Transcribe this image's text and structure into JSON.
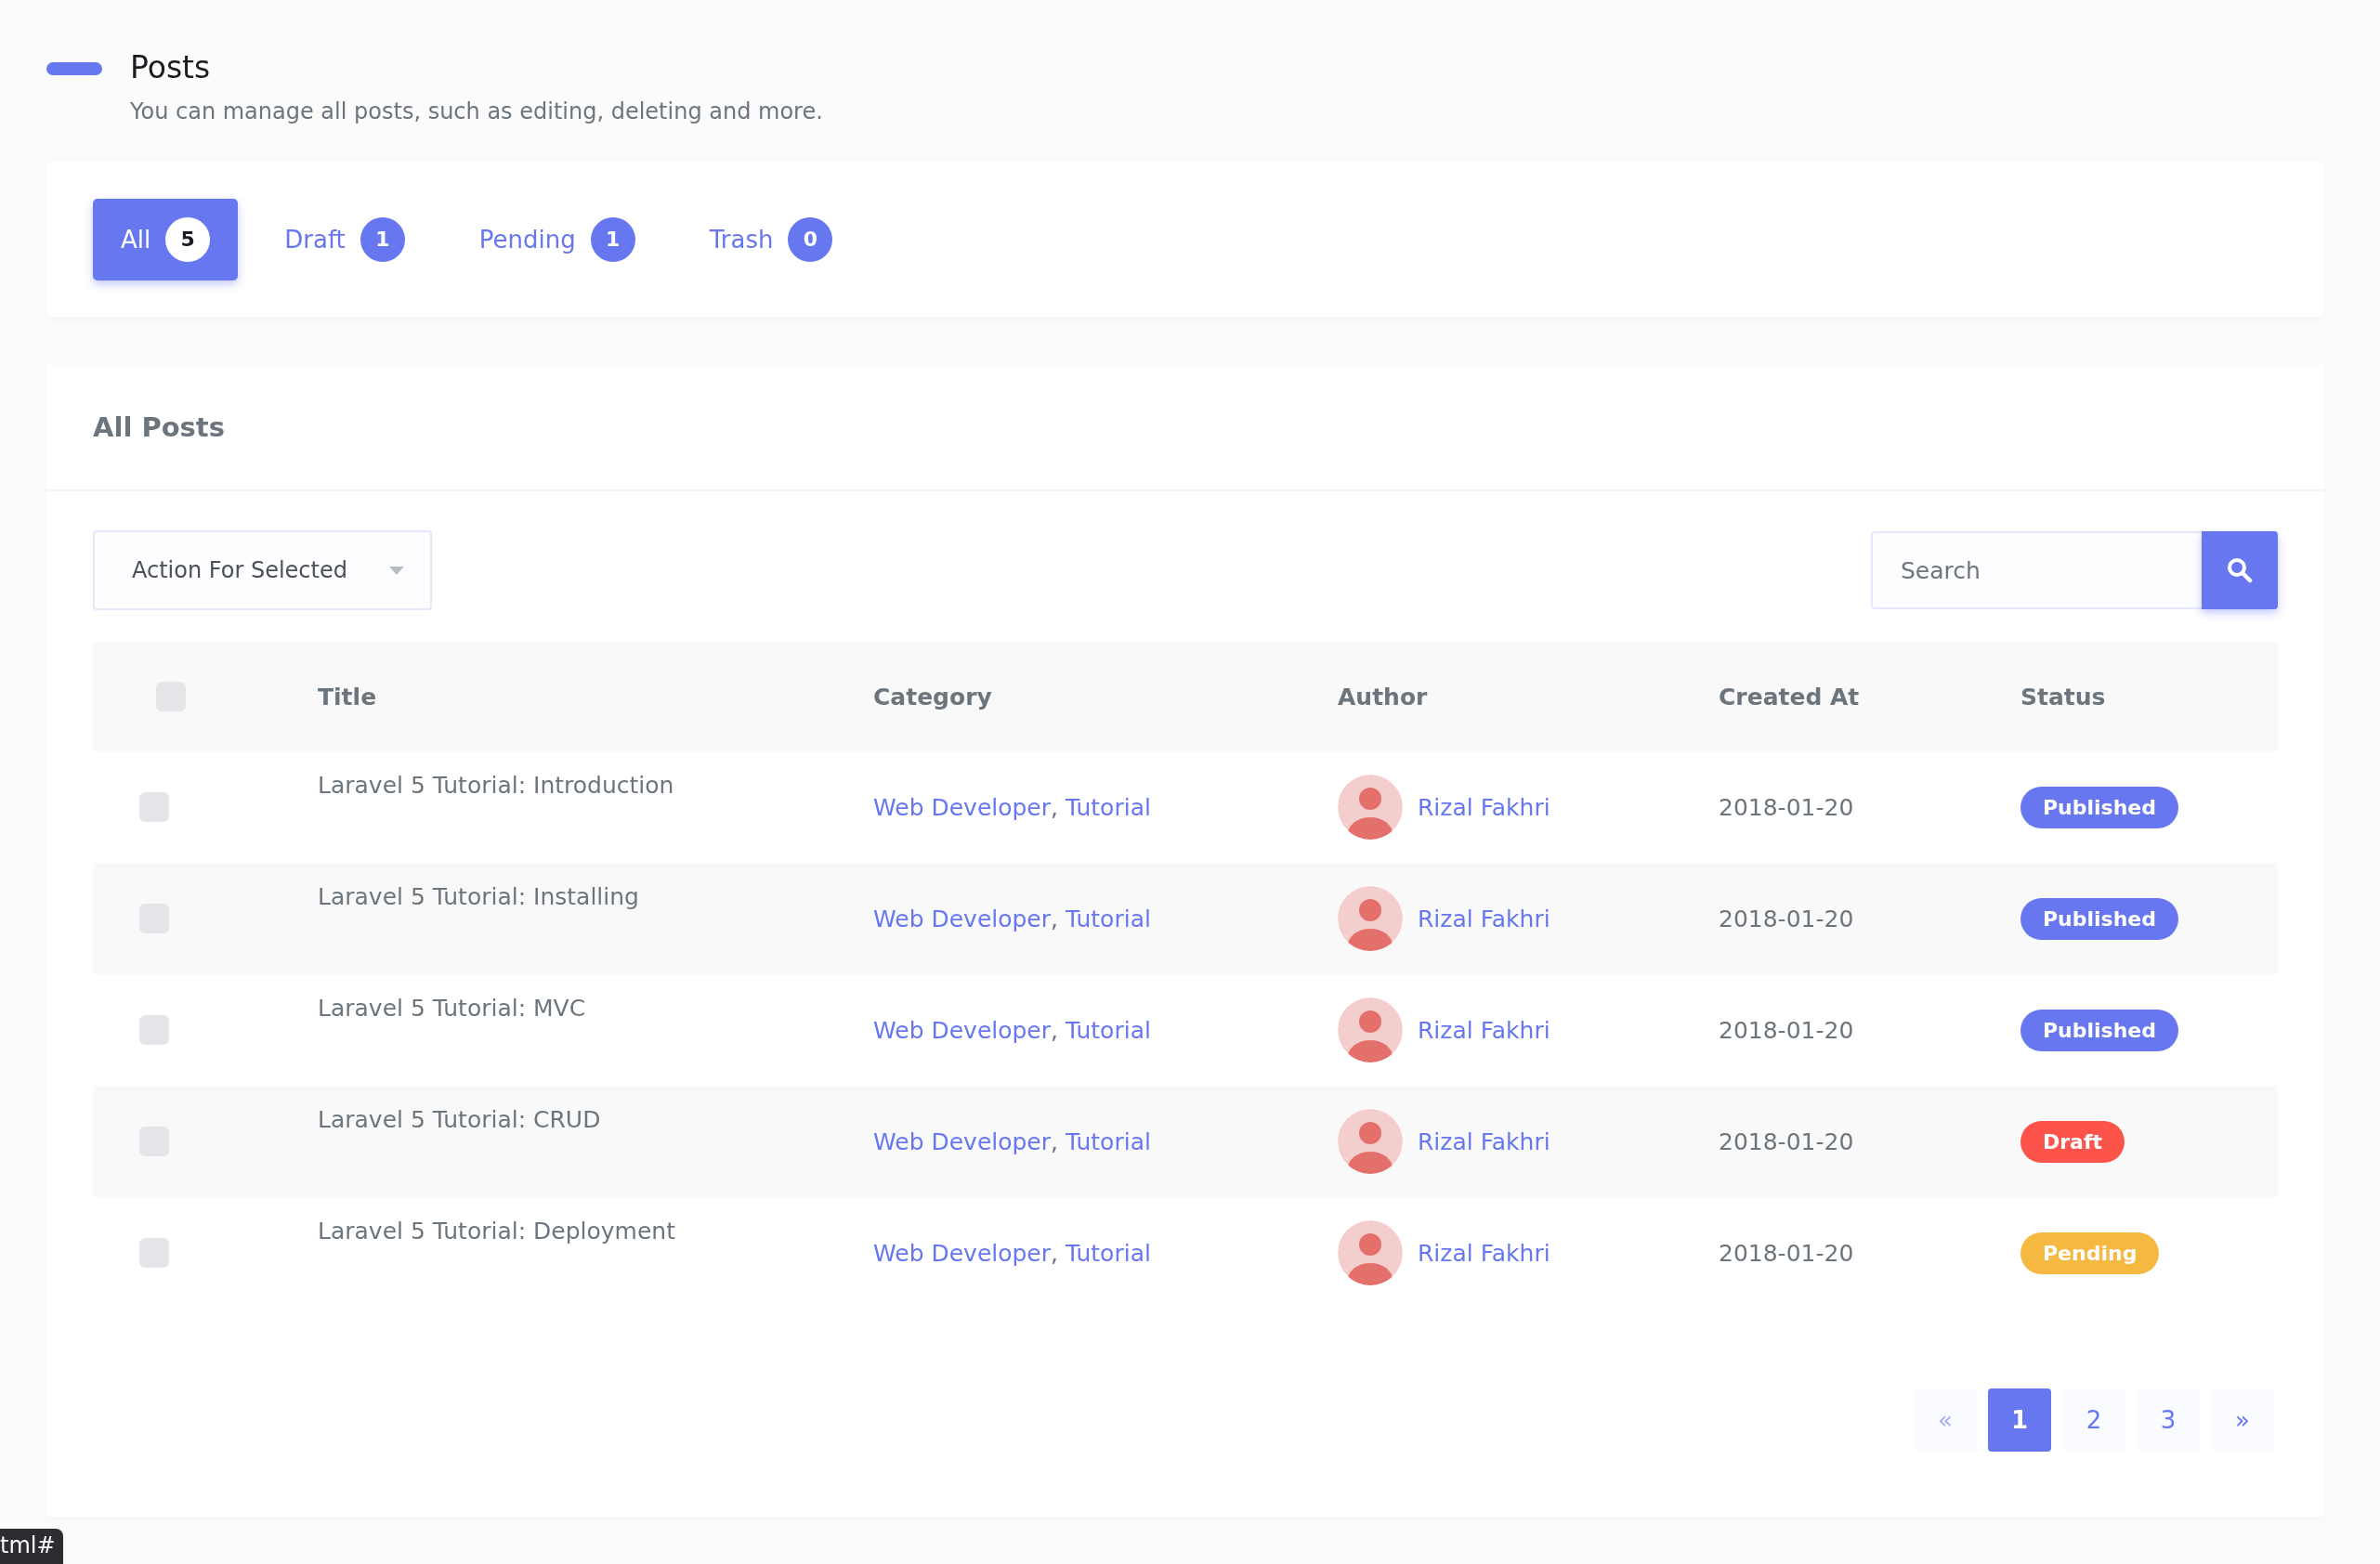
{
  "header": {
    "title": "Posts",
    "subtitle": "You can manage all posts, such as editing, deleting and more."
  },
  "tabs": [
    {
      "label": "All",
      "count": "5",
      "selected": true
    },
    {
      "label": "Draft",
      "count": "1",
      "selected": false
    },
    {
      "label": "Pending",
      "count": "1",
      "selected": false
    },
    {
      "label": "Trash",
      "count": "0",
      "selected": false
    }
  ],
  "card": {
    "title": "All Posts"
  },
  "action_select": {
    "value": "Action For Selected"
  },
  "search": {
    "placeholder": "Search"
  },
  "table": {
    "select_all": {
      "checked": false
    },
    "columns": [
      "Title",
      "Category",
      "Author",
      "Created At",
      "Status"
    ],
    "category_separator": ",",
    "rows": [
      {
        "checked": false,
        "title": "Laravel 5 Tutorial: Introduction",
        "categories": [
          "Web Developer",
          "Tutorial"
        ],
        "author": "Rizal Fakhri",
        "created_at": "2018-01-20",
        "status": {
          "label": "Published",
          "kind": "published"
        }
      },
      {
        "checked": false,
        "title": "Laravel 5 Tutorial: Installing",
        "categories": [
          "Web Developer",
          "Tutorial"
        ],
        "author": "Rizal Fakhri",
        "created_at": "2018-01-20",
        "status": {
          "label": "Published",
          "kind": "published"
        }
      },
      {
        "checked": false,
        "title": "Laravel 5 Tutorial: MVC",
        "categories": [
          "Web Developer",
          "Tutorial"
        ],
        "author": "Rizal Fakhri",
        "created_at": "2018-01-20",
        "status": {
          "label": "Published",
          "kind": "published"
        }
      },
      {
        "checked": false,
        "title": "Laravel 5 Tutorial: CRUD",
        "categories": [
          "Web Developer",
          "Tutorial"
        ],
        "author": "Rizal Fakhri",
        "created_at": "2018-01-20",
        "status": {
          "label": "Draft",
          "kind": "draft"
        }
      },
      {
        "checked": false,
        "title": "Laravel 5 Tutorial: Deployment",
        "categories": [
          "Web Developer",
          "Tutorial"
        ],
        "author": "Rizal Fakhri",
        "created_at": "2018-01-20",
        "status": {
          "label": "Pending",
          "kind": "pending"
        }
      }
    ]
  },
  "pagination": [
    {
      "label": "«",
      "selected": false
    },
    {
      "label": "1",
      "selected": true
    },
    {
      "label": "2",
      "selected": false
    },
    {
      "label": "3",
      "selected": false
    },
    {
      "label": "»",
      "selected": false
    }
  ],
  "link_tooltip": "tml#"
}
